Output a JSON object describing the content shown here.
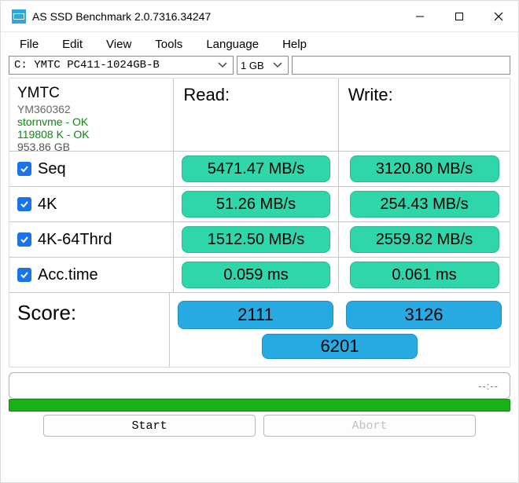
{
  "window": {
    "title": "AS SSD Benchmark 2.0.7316.34247"
  },
  "menu": {
    "file": "File",
    "edit": "Edit",
    "view": "View",
    "tools": "Tools",
    "language": "Language",
    "help": "Help"
  },
  "selectors": {
    "drive": "C: YMTC PC411-1024GB-B",
    "size": "1 GB"
  },
  "info": {
    "vendor": "YMTC",
    "model": "YM360362",
    "driver": "stornvme - OK",
    "alignment": "119808 K - OK",
    "capacity": "953.86 GB"
  },
  "headers": {
    "read": "Read:",
    "write": "Write:"
  },
  "tests": {
    "seq": {
      "label": "Seq",
      "read": "5471.47 MB/s",
      "write": "3120.80 MB/s"
    },
    "fk": {
      "label": "4K",
      "read": "51.26 MB/s",
      "write": "254.43 MB/s"
    },
    "fk64": {
      "label": "4K-64Thrd",
      "read": "1512.50 MB/s",
      "write": "2559.82 MB/s"
    },
    "acc": {
      "label": "Acc.time",
      "read": "0.059 ms",
      "write": "0.061 ms"
    }
  },
  "score": {
    "label": "Score:",
    "read": "2111",
    "write": "3126",
    "total": "6201"
  },
  "progress": {
    "text": "--:--"
  },
  "buttons": {
    "start": "Start",
    "abort": "Abort"
  }
}
